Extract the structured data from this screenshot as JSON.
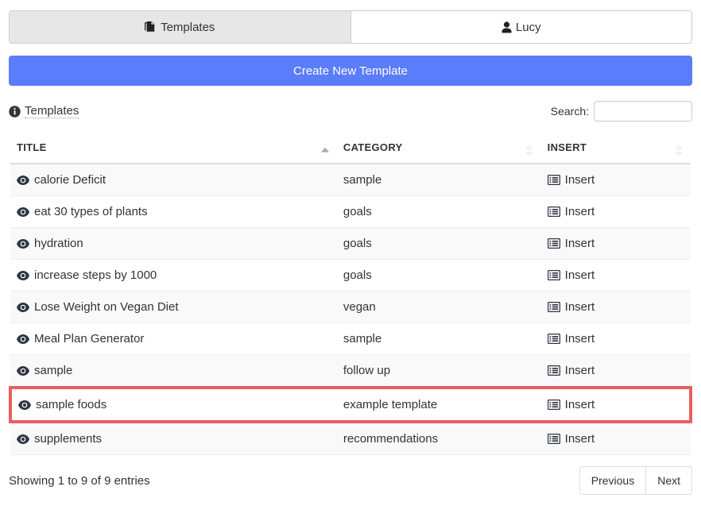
{
  "tabs": [
    {
      "label": "Templates",
      "icon": "copy-icon",
      "active": true
    },
    {
      "label": "Lucy",
      "icon": "user-icon",
      "active": false
    }
  ],
  "create_button": {
    "label": "Create New Template",
    "color": "#5a7dfc"
  },
  "panel": {
    "title": "Templates",
    "title_icon": "info-circle-icon"
  },
  "search": {
    "label": "Search:",
    "value": "",
    "placeholder": ""
  },
  "table": {
    "columns": [
      {
        "label": "TITLE",
        "sort": "asc"
      },
      {
        "label": "CATEGORY",
        "sort": "none"
      },
      {
        "label": "INSERT",
        "sort": "none"
      }
    ],
    "rows": [
      {
        "title": "calorie Deficit",
        "category": "sample",
        "insert": "Insert",
        "highlighted": false
      },
      {
        "title": "eat 30 types of plants",
        "category": "goals",
        "insert": "Insert",
        "highlighted": false
      },
      {
        "title": "hydration",
        "category": "goals",
        "insert": "Insert",
        "highlighted": false
      },
      {
        "title": "increase steps by 1000",
        "category": "goals",
        "insert": "Insert",
        "highlighted": false
      },
      {
        "title": "Lose Weight on Vegan Diet",
        "category": "vegan",
        "insert": "Insert",
        "highlighted": false
      },
      {
        "title": "Meal Plan Generator",
        "category": "sample",
        "insert": "Insert",
        "highlighted": false
      },
      {
        "title": "sample",
        "category": "follow up",
        "insert": "Insert",
        "highlighted": false
      },
      {
        "title": "sample foods",
        "category": "example template",
        "insert": "Insert",
        "highlighted": true
      },
      {
        "title": "supplements",
        "category": "recommendations",
        "insert": "Insert",
        "highlighted": false
      }
    ],
    "row_icon": "eye-icon",
    "insert_icon": "list-alt-icon",
    "highlight_color": "#e8615e"
  },
  "footer": {
    "info": "Showing 1 to 9 of 9 entries",
    "previous_label": "Previous",
    "next_label": "Next"
  }
}
